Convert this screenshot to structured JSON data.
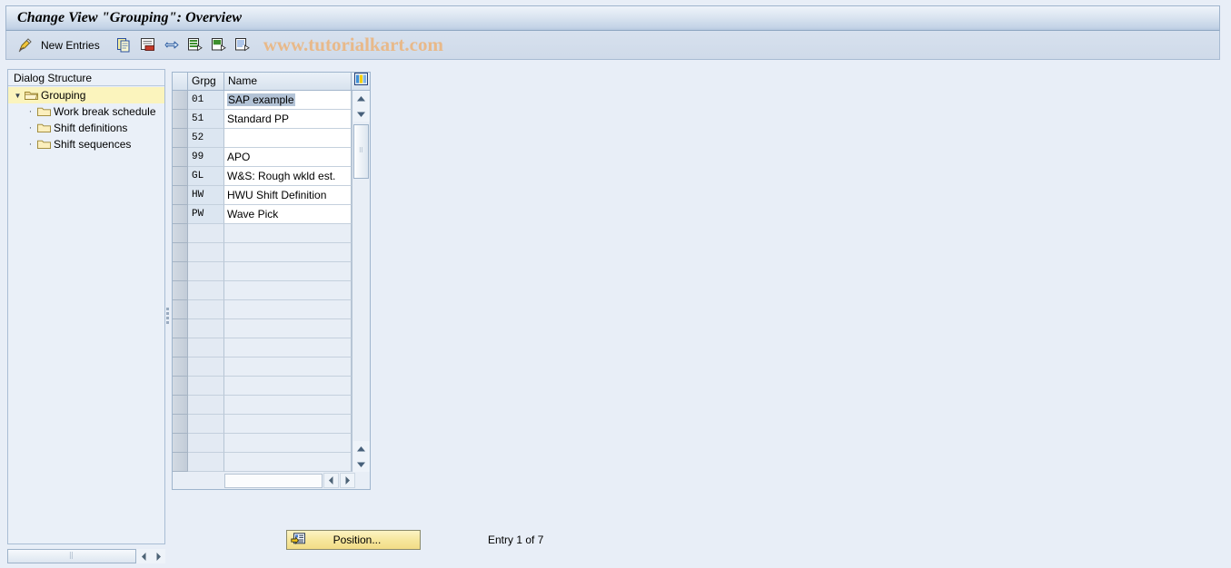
{
  "window": {
    "title": "Change View \"Grouping\": Overview"
  },
  "toolbar": {
    "edit_icon": "pencil-icon",
    "new_entries_label": "New Entries",
    "buttons": [
      {
        "name": "copy-as-icon",
        "title": "Copy As..."
      },
      {
        "name": "delete-icon",
        "title": "Delete"
      },
      {
        "name": "undo-icon",
        "title": "Undo Change"
      },
      {
        "name": "select-all-icon",
        "title": "Select All"
      },
      {
        "name": "deselect-all-icon",
        "title": "Deselect All"
      },
      {
        "name": "select-block-icon",
        "title": "Select Block"
      }
    ],
    "watermark": "www.tutorialkart.com"
  },
  "dialog_structure": {
    "header": "Dialog Structure",
    "items": [
      {
        "label": "Grouping",
        "level": 0,
        "expanded": true,
        "selected": true
      },
      {
        "label": "Work break schedule",
        "level": 1,
        "expanded": false,
        "selected": false
      },
      {
        "label": "Shift definitions",
        "level": 1,
        "expanded": false,
        "selected": false
      },
      {
        "label": "Shift sequences",
        "level": 1,
        "expanded": false,
        "selected": false
      }
    ]
  },
  "table": {
    "columns": [
      {
        "key": "grpg",
        "label": "Grpg"
      },
      {
        "key": "name",
        "label": "Name"
      }
    ],
    "config_icon": "table-settings-icon",
    "rows": [
      {
        "grpg": "01",
        "name": "SAP example",
        "selected_text": true
      },
      {
        "grpg": "51",
        "name": "Standard PP",
        "selected_text": false
      },
      {
        "grpg": "52",
        "name": "",
        "selected_text": false
      },
      {
        "grpg": "99",
        "name": "APO",
        "selected_text": false
      },
      {
        "grpg": "GL",
        "name": "W&S: Rough wkld est.",
        "selected_text": false
      },
      {
        "grpg": "HW",
        "name": "HWU Shift Definition",
        "selected_text": false
      },
      {
        "grpg": "PW",
        "name": "Wave Pick",
        "selected_text": false
      }
    ],
    "empty_row_count": 13
  },
  "footer": {
    "position_button_label": "Position...",
    "position_button_icon": "position-icon",
    "entry_status": "Entry 1 of 7"
  },
  "colors": {
    "title_bar_top": "#eef3fa",
    "title_bar_bottom": "#b6c8de",
    "page_background": "#e8eef7",
    "selection_yellow": "#fbf4bd",
    "text_selection": "#b3c3d6",
    "watermark": "#e8b98a",
    "button_yellow": "#f6e79e",
    "folder_yellow": "#f5d98a"
  }
}
